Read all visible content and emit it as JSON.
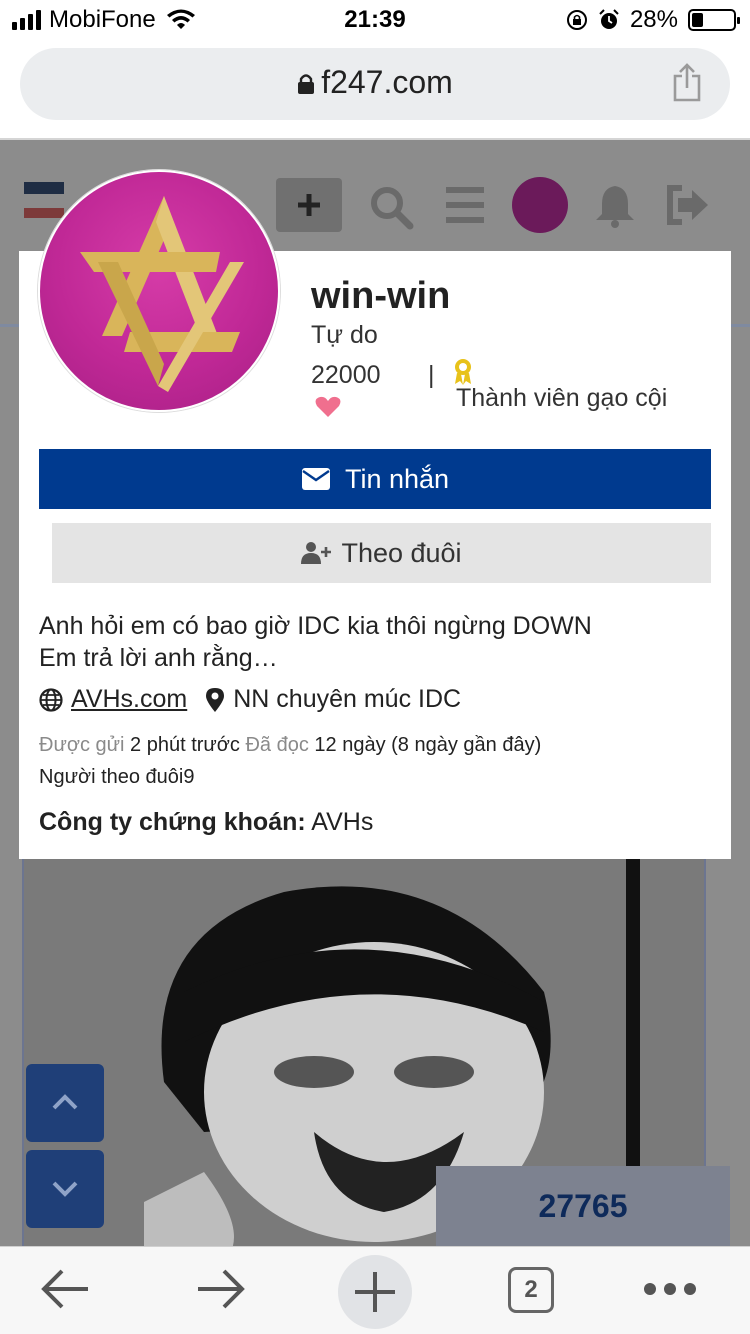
{
  "status_bar": {
    "carrier": "MobiFone",
    "time": "21:39",
    "battery": "28%",
    "battery_level": 0.28
  },
  "browser": {
    "url": "f247.com",
    "tab_count": "2"
  },
  "page_counter": "27765",
  "profile": {
    "username": "win-win",
    "title": "Tự do",
    "points": "22000",
    "separator": "|",
    "rank": "Thành viên gạo cội",
    "message_label": "Tin nhắn",
    "follow_label": "Theo đuôi",
    "bio_line1": "Anh hỏi em có bao giờ IDC kia thôi ngừng DOWN",
    "bio_line2": "Em trả lời anh rằng…",
    "website": "AVHs.com",
    "location": "NN chuyên múc IDC",
    "posted_label": "Được gửi",
    "posted_value": "2 phút trước",
    "read_label": "Đã đọc",
    "read_value": "12 ngày (8 ngày gần đây)",
    "followers": "Người theo đuôi9",
    "company_label": "Công ty chứng khoán:",
    "company_value": "AVHs"
  },
  "colors": {
    "primary_button": "#003a8f",
    "avatar_magenta": "#c02896",
    "avatar_gold": "#d9b55a"
  },
  "icons": {
    "message": "envelope-icon",
    "follow": "user-plus-icon",
    "website": "globe-icon",
    "location": "map-pin-icon",
    "rank": "award-icon",
    "like": "heart-icon"
  }
}
